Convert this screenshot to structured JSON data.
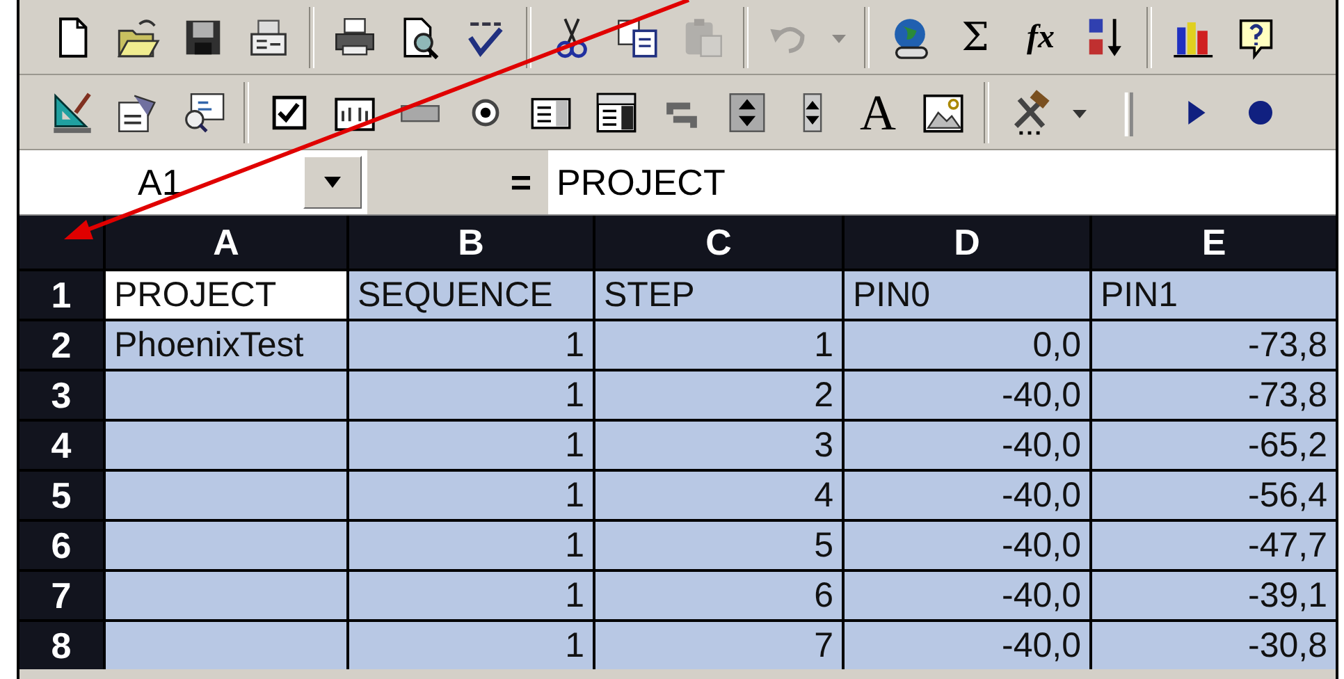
{
  "toolbars": [
    [
      {
        "kind": "new",
        "disabled": false
      },
      {
        "kind": "open",
        "disabled": false
      },
      {
        "kind": "save",
        "disabled": false
      },
      {
        "kind": "mail",
        "disabled": false
      },
      {
        "kind": "separator"
      },
      {
        "kind": "print",
        "disabled": false
      },
      {
        "kind": "preview",
        "disabled": false
      },
      {
        "kind": "spell",
        "disabled": false
      },
      {
        "kind": "separator"
      },
      {
        "kind": "cut",
        "disabled": false
      },
      {
        "kind": "copy",
        "disabled": false
      },
      {
        "kind": "paste",
        "disabled": true
      },
      {
        "kind": "separator"
      },
      {
        "kind": "undo",
        "disabled": true
      },
      {
        "kind": "caret",
        "disabled": true
      },
      {
        "kind": "separator"
      },
      {
        "kind": "web",
        "disabled": false
      },
      {
        "kind": "glyph",
        "label": "Σ",
        "disabled": false
      },
      {
        "kind": "italic",
        "label": "fx",
        "disabled": false
      },
      {
        "kind": "sort",
        "disabled": false
      },
      {
        "kind": "separator"
      },
      {
        "kind": "chart",
        "disabled": false
      },
      {
        "kind": "help",
        "disabled": false
      }
    ],
    [
      {
        "kind": "drawing",
        "disabled": false
      },
      {
        "kind": "properties",
        "disabled": false
      },
      {
        "kind": "viewcode",
        "disabled": false
      },
      {
        "kind": "separator"
      },
      {
        "kind": "checkbox",
        "disabled": false
      },
      {
        "kind": "editbox",
        "disabled": false
      },
      {
        "kind": "button",
        "disabled": false
      },
      {
        "kind": "radio",
        "disabled": false
      },
      {
        "kind": "listbox",
        "disabled": false
      },
      {
        "kind": "combo",
        "disabled": false
      },
      {
        "kind": "scrollbar",
        "disabled": false
      },
      {
        "kind": "spinner",
        "disabled": false
      },
      {
        "kind": "spinsmall",
        "disabled": false
      },
      {
        "kind": "serif",
        "label": "A",
        "disabled": false
      },
      {
        "kind": "image",
        "disabled": false
      },
      {
        "kind": "separator"
      },
      {
        "kind": "tools",
        "disabled": false
      },
      {
        "kind": "caret",
        "disabled": false
      },
      {
        "kind": "grip"
      },
      {
        "kind": "run",
        "disabled": false
      },
      {
        "kind": "record",
        "disabled": false
      }
    ]
  ],
  "formula_bar": {
    "name_box": "A1",
    "equals": "=",
    "formula": "PROJECT"
  },
  "sheet": {
    "columns": [
      "A",
      "B",
      "C",
      "D",
      "E"
    ],
    "rows": [
      {
        "number": "1",
        "cells": [
          {
            "kind": "text",
            "text": "PROJECT",
            "active": true
          },
          {
            "kind": "text",
            "text": "SEQUENCE",
            "active": false
          },
          {
            "kind": "text",
            "text": "STEP",
            "active": false
          },
          {
            "kind": "text",
            "text": "PIN0",
            "active": false
          },
          {
            "kind": "text",
            "text": "PIN1",
            "active": false
          }
        ]
      },
      {
        "number": "2",
        "cells": [
          {
            "kind": "text",
            "text": "PhoenixTest",
            "active": false
          },
          {
            "kind": "number",
            "text": "1",
            "active": false
          },
          {
            "kind": "number",
            "text": "1",
            "active": false
          },
          {
            "kind": "number",
            "text": "0,0",
            "active": false
          },
          {
            "kind": "number",
            "text": "-73,8",
            "active": false
          }
        ]
      },
      {
        "number": "3",
        "cells": [
          {
            "kind": "empty",
            "active": false
          },
          {
            "kind": "number",
            "text": "1",
            "active": false
          },
          {
            "kind": "number",
            "text": "2",
            "active": false
          },
          {
            "kind": "number",
            "text": "-40,0",
            "active": false
          },
          {
            "kind": "number",
            "text": "-73,8",
            "active": false
          }
        ]
      },
      {
        "number": "4",
        "cells": [
          {
            "kind": "empty",
            "active": false
          },
          {
            "kind": "number",
            "text": "1",
            "active": false
          },
          {
            "kind": "number",
            "text": "3",
            "active": false
          },
          {
            "kind": "number",
            "text": "-40,0",
            "active": false
          },
          {
            "kind": "number",
            "text": "-65,2",
            "active": false
          }
        ]
      },
      {
        "number": "5",
        "cells": [
          {
            "kind": "empty",
            "active": false
          },
          {
            "kind": "number",
            "text": "1",
            "active": false
          },
          {
            "kind": "number",
            "text": "4",
            "active": false
          },
          {
            "kind": "number",
            "text": "-40,0",
            "active": false
          },
          {
            "kind": "number",
            "text": "-56,4",
            "active": false
          }
        ]
      },
      {
        "number": "6",
        "cells": [
          {
            "kind": "empty",
            "active": false
          },
          {
            "kind": "number",
            "text": "1",
            "active": false
          },
          {
            "kind": "number",
            "text": "5",
            "active": false
          },
          {
            "kind": "number",
            "text": "-40,0",
            "active": false
          },
          {
            "kind": "number",
            "text": "-47,7",
            "active": false
          }
        ]
      },
      {
        "number": "7",
        "cells": [
          {
            "kind": "empty",
            "active": false
          },
          {
            "kind": "number",
            "text": "1",
            "active": false
          },
          {
            "kind": "number",
            "text": "6",
            "active": false
          },
          {
            "kind": "number",
            "text": "-40,0",
            "active": false
          },
          {
            "kind": "number",
            "text": "-39,1",
            "active": false
          }
        ]
      },
      {
        "number": "8",
        "cells": [
          {
            "kind": "empty",
            "active": false
          },
          {
            "kind": "number",
            "text": "1",
            "active": false
          },
          {
            "kind": "number",
            "text": "7",
            "active": false
          },
          {
            "kind": "number",
            "text": "-40,0",
            "active": false
          },
          {
            "kind": "number",
            "text": "-30,8",
            "active": false
          }
        ]
      }
    ]
  }
}
